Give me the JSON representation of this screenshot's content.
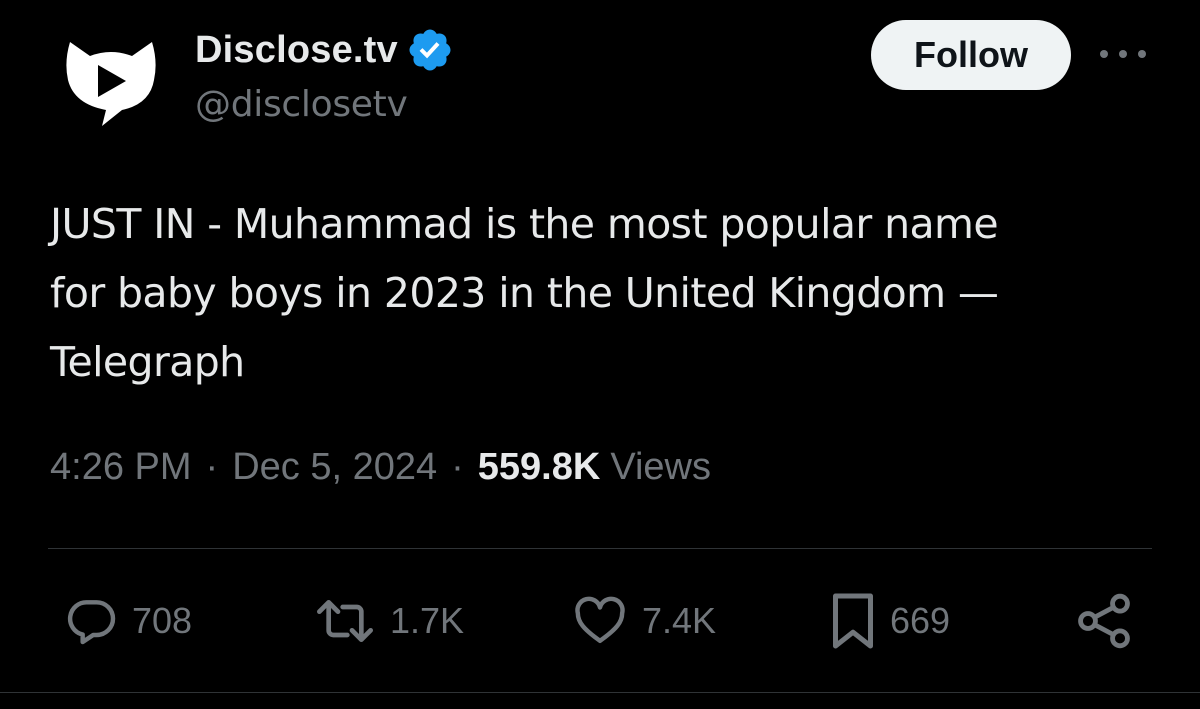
{
  "account": {
    "display_name": "Disclose.tv",
    "handle": "@disclosetv",
    "verified": true,
    "verified_color": "#1d9bf0",
    "avatar_icon": "play-speech-bubble-logo"
  },
  "header": {
    "follow_label": "Follow",
    "more_icon": "more-dots-icon"
  },
  "tweet": {
    "text_line_1": "JUST IN - Muhammad is the most popular name",
    "text_line_2": "for baby boys in 2023 in the United Kingdom —",
    "text_line_3": "Telegraph"
  },
  "meta": {
    "time": "4:26 PM",
    "separator": "·",
    "date": "Dec 5, 2024",
    "views_count": "559.8K",
    "views_label": "Views"
  },
  "actions": {
    "replies": "708",
    "reposts": "1.7K",
    "likes": "7.4K",
    "bookmarks": "669"
  },
  "colors": {
    "background": "#000000",
    "text_primary": "#e7e9ea",
    "text_secondary": "#71767b",
    "divider": "#2f3336",
    "follow_button_bg": "#eff3f4"
  }
}
